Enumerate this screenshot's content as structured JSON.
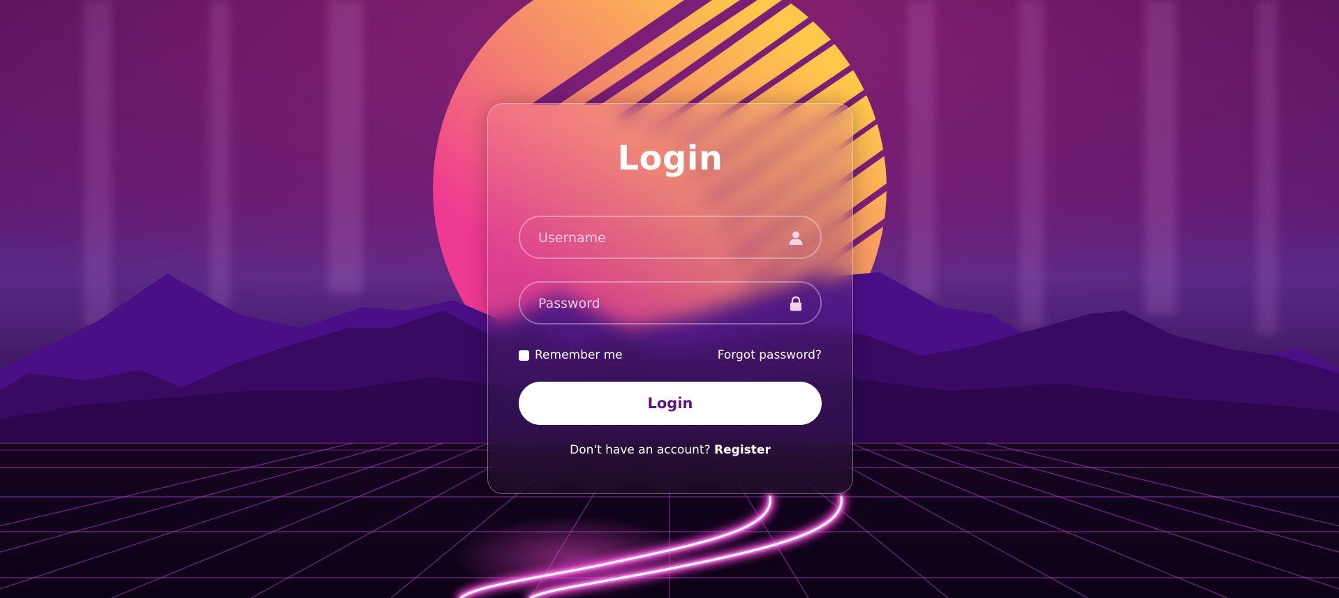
{
  "login": {
    "title": "Login",
    "username": {
      "placeholder": "Username",
      "value": "",
      "icon": "user-icon"
    },
    "password": {
      "placeholder": "Password",
      "value": "",
      "icon": "lock-icon"
    },
    "remember_label": "Remember me",
    "remember_checked": false,
    "forgot_label": "Forgot password?",
    "submit_label": "Login",
    "register_prompt": "Don't have an account?",
    "register_label": "Register"
  },
  "colors": {
    "background_sky": "#3a0a5c",
    "sun_top": "#ffc24a",
    "sun_bottom": "#f0378f",
    "mountains": "#3e0a6e",
    "grid_lines": "#c04cd6",
    "button_text": "#5b1681"
  }
}
